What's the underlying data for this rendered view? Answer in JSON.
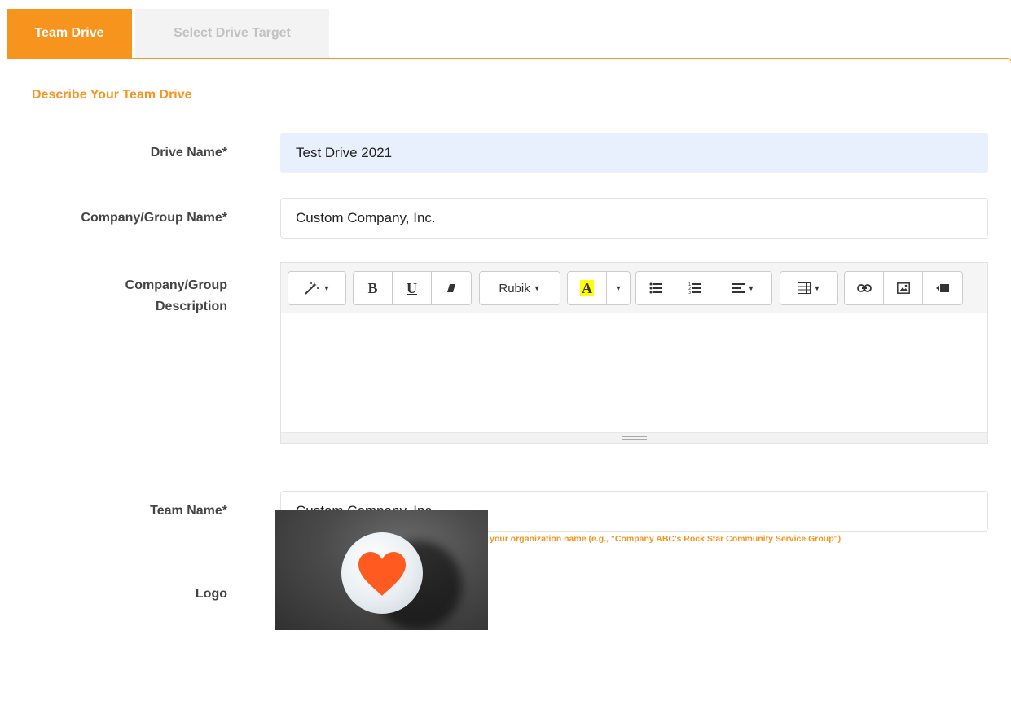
{
  "tabs": [
    {
      "label": "Team Drive",
      "active": true
    },
    {
      "label": "Select Drive Target",
      "active": false
    }
  ],
  "section_title": "Describe Your Team Drive",
  "fields": {
    "drive_name": {
      "label": "Drive Name*",
      "value": "Test Drive 2021"
    },
    "company_name": {
      "label": "Company/Group Name*",
      "value": "Custom Company, Inc."
    },
    "description": {
      "label_line1": "Company/Group",
      "label_line2": "Description"
    },
    "team_name": {
      "label": "Team Name*",
      "value": "Custom Company, Inc.",
      "hint": "You may choose a team name that is different from your organization name (e.g., \"Company ABC's Rock Star Community Service Group\")"
    },
    "logo": {
      "label": "Logo"
    }
  },
  "toolbar": {
    "font_name": "Rubik",
    "icons": [
      "magic-icon",
      "bold-icon",
      "underline-icon",
      "eraser-icon",
      "font-dropdown",
      "highlight-icon",
      "unordered-list-icon",
      "ordered-list-icon",
      "align-icon",
      "table-icon",
      "link-icon",
      "image-icon",
      "video-icon"
    ]
  },
  "colors": {
    "accent": "#f7941d",
    "autofill_bg": "#e8f0fe",
    "highlight": "#ffff00",
    "heart": "#ff5a1f"
  }
}
